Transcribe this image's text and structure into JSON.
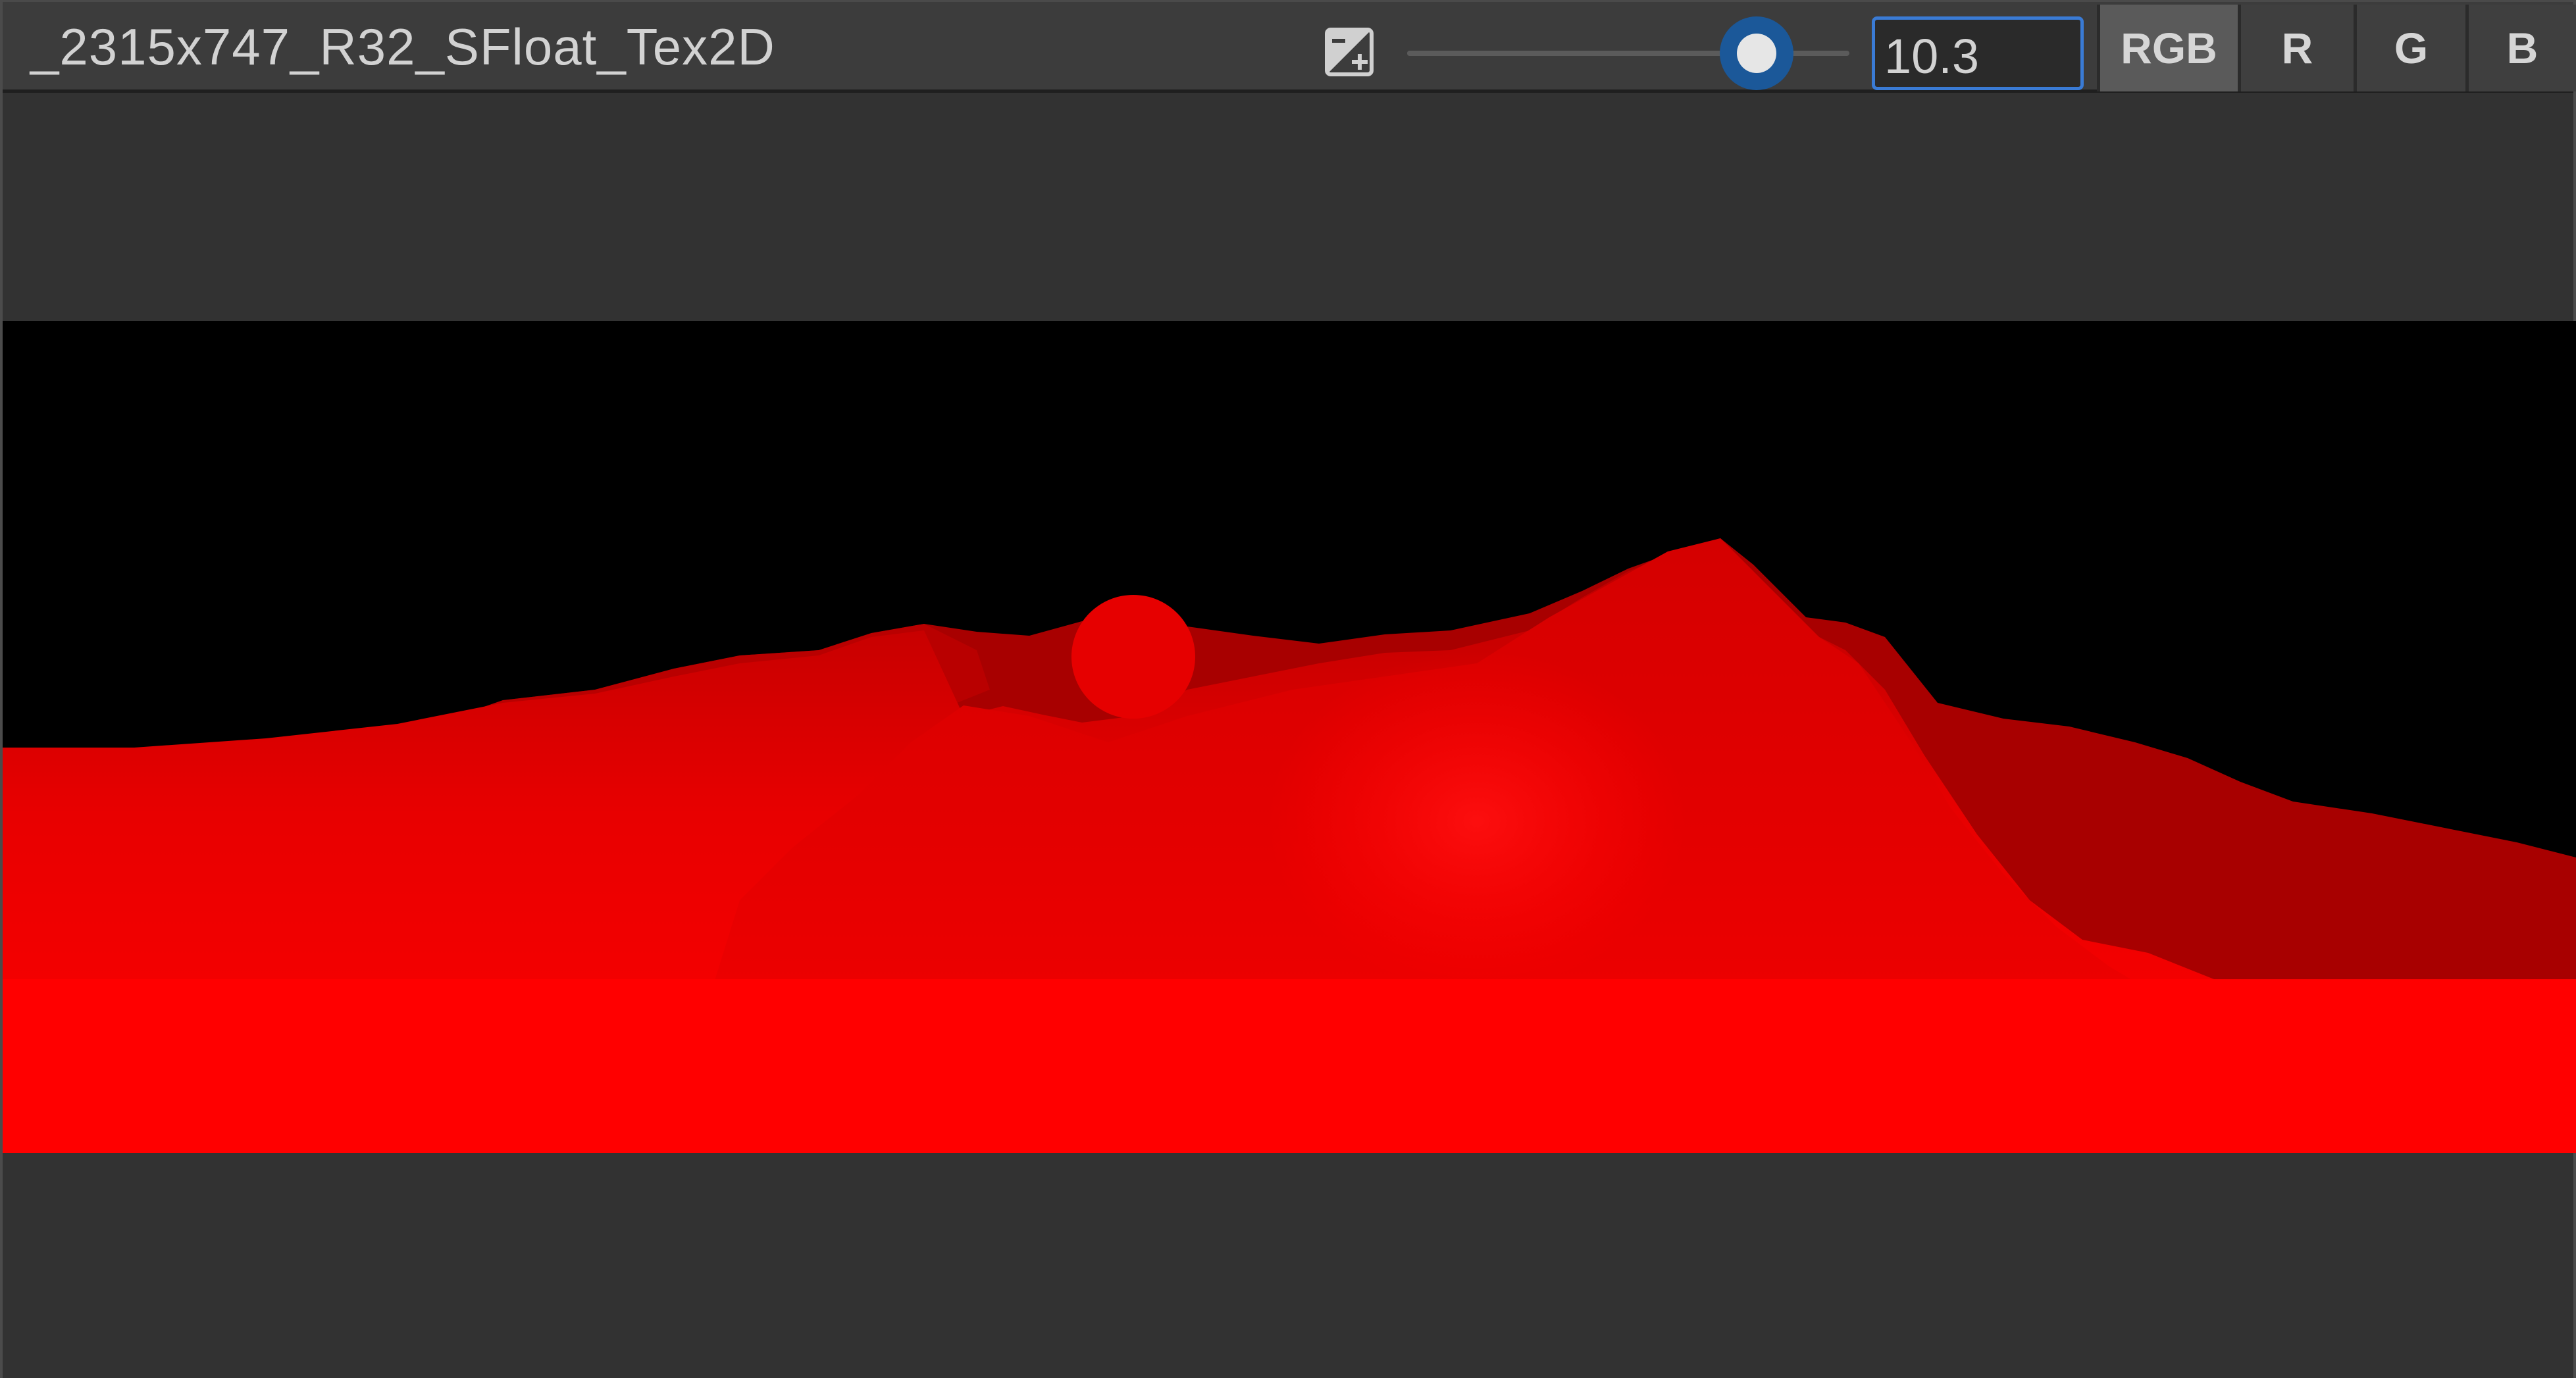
{
  "window": {
    "title": "_2315x747_R32_SFloat_Tex2D"
  },
  "toolbar": {
    "exposure_icon": "exposure-icon",
    "exposure_slider": {
      "value_fraction": 0.79
    },
    "exposure_value": "10.3",
    "channels": [
      {
        "label": "RGB",
        "active": true
      },
      {
        "label": "R",
        "active": false
      },
      {
        "label": "G",
        "active": false
      },
      {
        "label": "B",
        "active": false
      }
    ]
  },
  "viewport": {
    "description_colors": {
      "background": "#000000",
      "terrain_bright": "#ff0000",
      "terrain_dark": "#a00000"
    }
  }
}
